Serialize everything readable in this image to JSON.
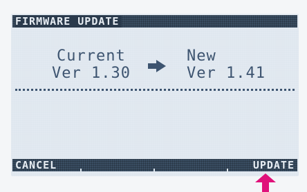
{
  "screen": {
    "title": "FIRMWARE UPDATE"
  },
  "versions": {
    "current_label": "Current",
    "current_version": "Ver 1.30",
    "new_label": "New",
    "new_version": "Ver 1.41"
  },
  "softkeys": {
    "cancel_label": "CANCEL",
    "update_label": "UPDATE"
  },
  "icons": {
    "arrow": "arrow-right-icon",
    "pointer": "pointer-arrow-up-icon"
  },
  "colors": {
    "lcd_background": "#dfe7ef",
    "lcd_text": "#3d5470",
    "bar_background": "#3a4e63",
    "bar_text": "#e8eef4",
    "pointer": "#e0117a"
  }
}
